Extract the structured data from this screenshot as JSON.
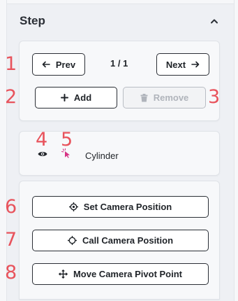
{
  "panel": {
    "title": "Step"
  },
  "navigation": {
    "prev_label": "Prev",
    "page_indicator": "1 / 1",
    "next_label": "Next"
  },
  "actions": {
    "add_label": "Add",
    "remove_label": "Remove"
  },
  "object": {
    "name": "Cylinder",
    "visibility_icon": "eye-icon",
    "select_icon": "cursor-click-icon"
  },
  "camera": {
    "set_label": "Set Camera Position",
    "call_label": "Call Camera Position",
    "move_pivot_label": "Move Camera Pivot Point"
  },
  "markers": [
    "1",
    "2",
    "3",
    "4",
    "5",
    "6",
    "7",
    "8"
  ],
  "colors": {
    "marker": "#e8535c",
    "select_icon": "#d63384",
    "text": "#1f2328",
    "disabled": "#b0b4bb"
  }
}
